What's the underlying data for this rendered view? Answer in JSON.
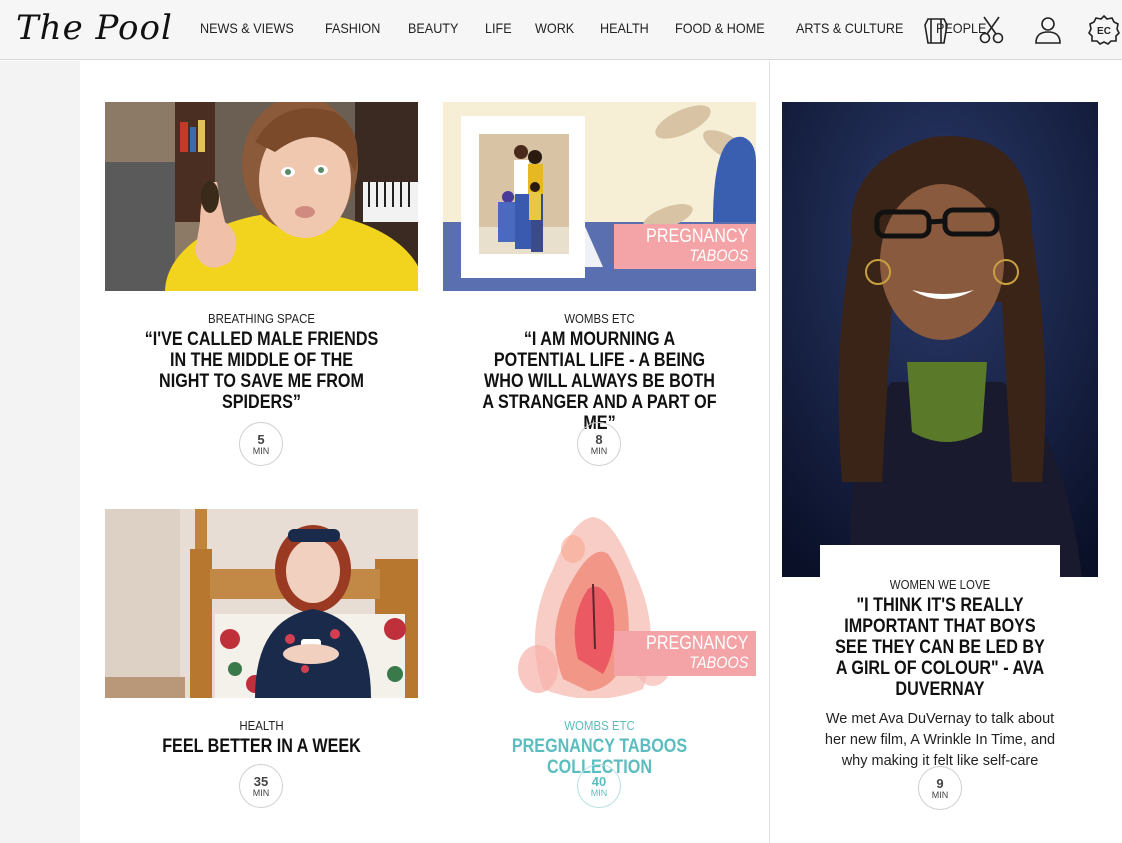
{
  "logo": "The Pool",
  "nav": [
    "NEWS & VIEWS",
    "FASHION",
    "BEAUTY",
    "LIFE",
    "WORK",
    "HEALTH",
    "FOOD & HOME",
    "ARTS & CULTURE",
    "PEOPLE"
  ],
  "header_icons": [
    "cup-icon",
    "scissors-icon",
    "user-icon",
    "ec-icon"
  ],
  "header_icon_labels": {
    "ec": "EC"
  },
  "cards": [
    {
      "category": "BREATHING SPACE",
      "title": "“I'VE CALLED MALE FRIENDS IN THE MIDDLE OF THE NIGHT TO SAVE ME FROM SPIDERS”",
      "time": "5",
      "unit": "MIN"
    },
    {
      "category": "WOMBS ETC",
      "title": "“I AM MOURNING A POTENTIAL LIFE - A BEING WHO WILL ALWAYS BE BOTH A STRANGER AND A PART OF ME”",
      "time": "8",
      "unit": "MIN",
      "tag_a": "PREGNANCY",
      "tag_b": "TABOOS"
    },
    {
      "category": "HEALTH",
      "title": "FEEL BETTER IN A WEEK",
      "time": "35",
      "unit": "MIN"
    },
    {
      "category": "WOMBS ETC",
      "title": "PREGNANCY TABOOS COLLECTION",
      "time": "40",
      "unit": "MIN",
      "tag_a": "PREGNANCY",
      "tag_b": "TABOOS"
    }
  ],
  "feature": {
    "category": "WOMEN WE LOVE",
    "title": "\"I THINK IT'S REALLY IMPORTANT THAT BOYS SEE THEY CAN BE LED BY A GIRL OF COLOUR\" - AVA DUVERNAY",
    "subtitle": "We met Ava DuVernay to talk about her new film, A Wrinkle In Time, and why making it felt like self-care",
    "time": "9",
    "unit": "MIN"
  },
  "colors": {
    "teal": "#5bbdbf",
    "pink_tag": "#f4a3a6",
    "header_bg": "#f6f6f6"
  }
}
